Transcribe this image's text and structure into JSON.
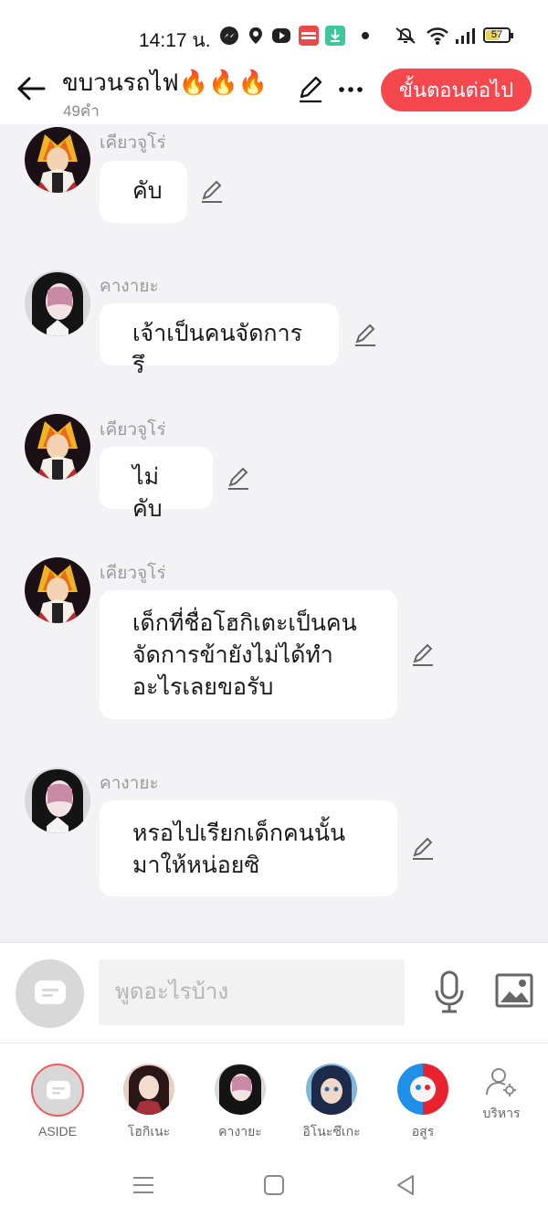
{
  "status_bar": {
    "time": "14:17 น.",
    "battery": "57",
    "icons": [
      "messenger-icon",
      "location-icon",
      "play-icon",
      "manga-toon-icon",
      "download-icon",
      "dot-icon",
      "mute-icon",
      "wifi-icon",
      "signal-icon",
      "battery-icon"
    ]
  },
  "header": {
    "title": "ขบวนรถไฟ🔥🔥🔥",
    "word_count": "49คำ",
    "next_button": "ขั้นตอนต่อไป"
  },
  "messages": [
    {
      "sender": "เคียวจูโร่",
      "text": "คับ"
    },
    {
      "sender": "คางายะ",
      "text": "เจ้าเป็นคนจัดการรึ"
    },
    {
      "sender": "เคียวจูโร่",
      "text": "ไม่คับ"
    },
    {
      "sender": "เคียวจูโร่",
      "text": "เด็กที่ชื่อโฮกิเตะเป็นคน\nจัดการข้ายังไม่ได้ทำ\nอะไรเลยขอรับ"
    },
    {
      "sender": "คางายะ",
      "text": "หรอไปเรียกเด็กคนนั้น\nมาให้หน่อยซิ"
    }
  ],
  "input": {
    "placeholder": "พูดอะไรบ้าง"
  },
  "characters": [
    {
      "label": "ASIDE"
    },
    {
      "label": "โฮกิเนะ"
    },
    {
      "label": "คางายะ"
    },
    {
      "label": "อิโนะซึเกะ"
    },
    {
      "label": "อสูร"
    },
    {
      "label": "บริหาร"
    }
  ],
  "colors": {
    "accent": "#f4484e",
    "chat_bg": "#f3f3f5"
  }
}
